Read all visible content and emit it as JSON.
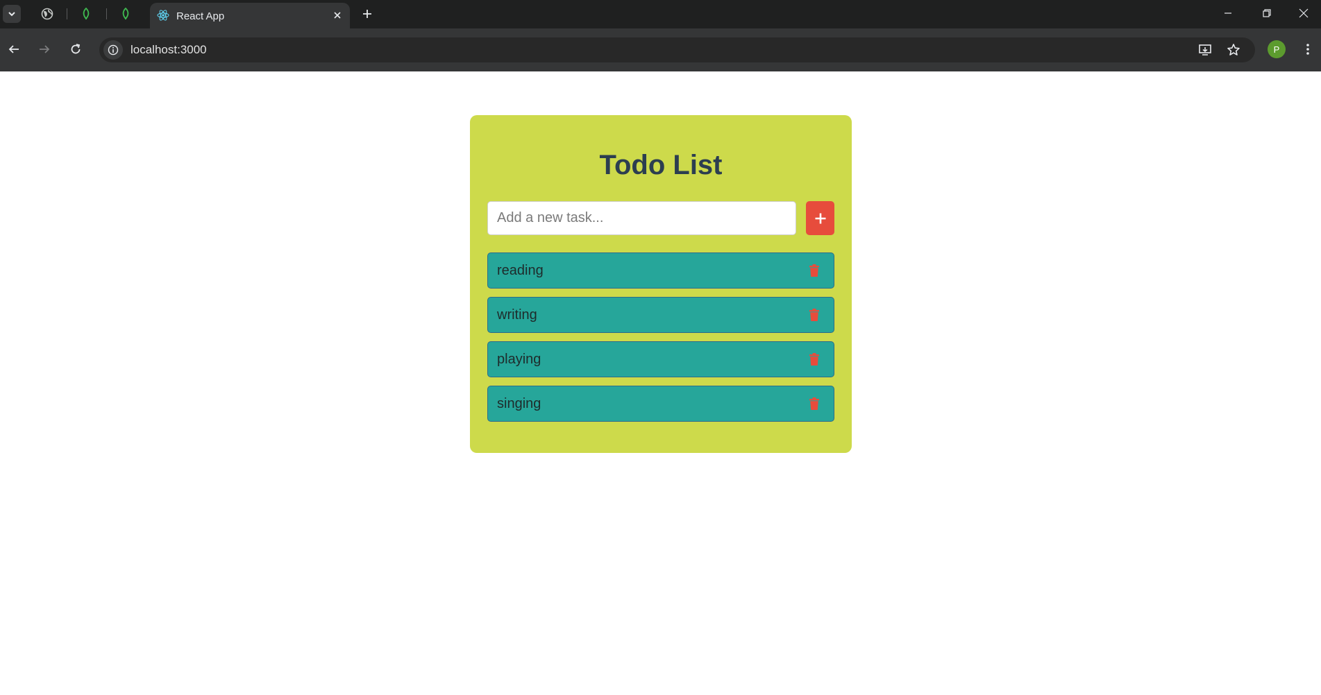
{
  "browser": {
    "active_tab_title": "React App",
    "url": "localhost:3000",
    "profile_initial": "P",
    "colors": {
      "tabbar": "#1f2020",
      "toolbar": "#353637",
      "omnibox": "#282828",
      "profile": "#5c9b2e"
    },
    "icons": [
      "tab-search-icon",
      "globe-icon",
      "mongodb-leaf-icon",
      "react-atom-icon",
      "close-icon",
      "plus-icon",
      "minimize-icon",
      "restore-icon",
      "back-arrow-icon",
      "forward-arrow-icon",
      "reload-icon",
      "site-info-icon",
      "install-app-icon",
      "star-icon",
      "more-vert-icon"
    ]
  },
  "app": {
    "title": "Todo List",
    "input_placeholder": "Add a new task...",
    "input_value": "",
    "todos": [
      {
        "text": "reading"
      },
      {
        "text": "writing"
      },
      {
        "text": "playing"
      },
      {
        "text": "singing"
      }
    ],
    "colors": {
      "card_background": "#cdda4b",
      "title": "#2c3e50",
      "add_button": "#e74c3c",
      "todo_item": "#26a69a",
      "delete_icon": "#e74c3c"
    }
  }
}
